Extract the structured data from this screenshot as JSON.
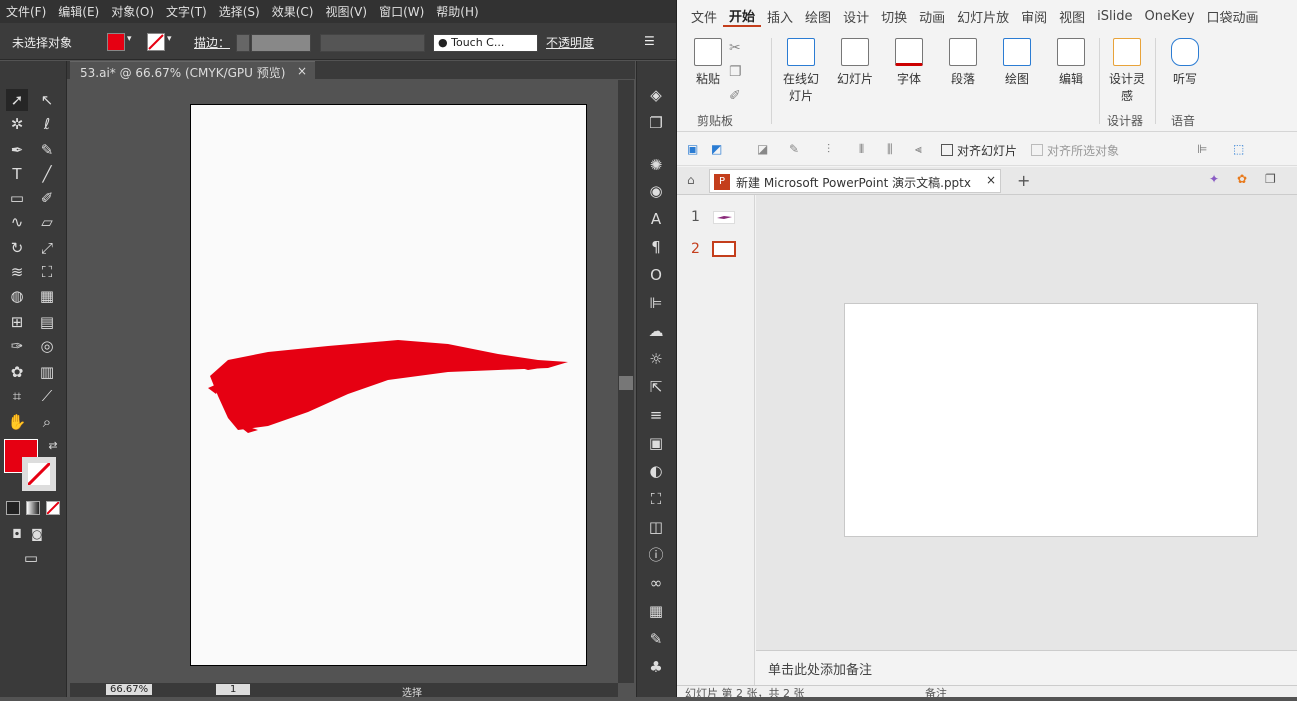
{
  "ai": {
    "menu": [
      "文件(F)",
      "编辑(E)",
      "对象(O)",
      "文字(T)",
      "选择(S)",
      "效果(C)",
      "视图(V)",
      "窗口(W)",
      "帮助(H)"
    ],
    "control": {
      "selection": "未选择对象",
      "stroke_label": "描边：",
      "brush": "Touch C...",
      "opacity": "不透明度"
    },
    "doc_tab": "53.ai* @ 66.67% (CMYK/GPU 预览)",
    "tab_close": "×",
    "status": {
      "zoom": "66.67%",
      "page": "1",
      "mode": "选择"
    },
    "colors": {
      "fill": "#e60012",
      "brush": "#e60012"
    }
  },
  "ppt": {
    "tabs": [
      "文件",
      "开始",
      "插入",
      "绘图",
      "设计",
      "切换",
      "动画",
      "幻灯片放",
      "审阅",
      "视图",
      "iSlide",
      "OneKey",
      "口袋动画"
    ],
    "active_tab": "开始",
    "ribbon": {
      "paste": "粘贴",
      "clipboard": "剪贴板",
      "online": "在线幻灯片",
      "slide": "幻灯片",
      "font": "字体",
      "paragraph": "段落",
      "drawing": "绘图",
      "edit": "编辑",
      "designer": "设计灵感",
      "designer_grp": "设计器",
      "dictate": "听写",
      "voice": "语音"
    },
    "qbar": {
      "align_slide": "对齐幻灯片",
      "align_sel": "对齐所选对象"
    },
    "file_tab": "新建 Microsoft PowerPoint 演示文稿.pptx",
    "slides": [
      "1",
      "2"
    ],
    "notes": "单击此处添加备注",
    "status": "幻灯片 第 2 张，共 2 张",
    "status_notes": "备注"
  }
}
